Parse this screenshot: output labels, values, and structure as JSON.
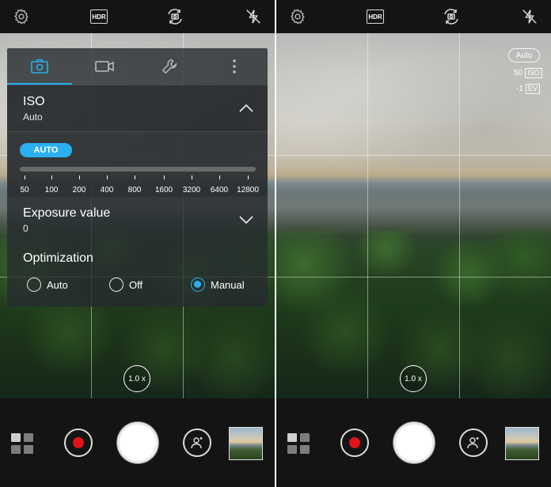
{
  "left": {
    "topbar": {
      "hdr_label": "HDR"
    },
    "panel": {
      "tabs": [
        {
          "name": "photo",
          "icon": "camera-icon",
          "active": true
        },
        {
          "name": "video",
          "icon": "video-camera-icon",
          "active": false
        },
        {
          "name": "tools",
          "icon": "wrench-icon",
          "active": false
        },
        {
          "name": "more",
          "icon": "more-vertical-icon",
          "active": false
        }
      ],
      "iso": {
        "title": "ISO",
        "value": "Auto",
        "auto_label": "AUTO",
        "ticks": [
          "50",
          "100",
          "200",
          "400",
          "800",
          "1600",
          "3200",
          "6400",
          "12800"
        ]
      },
      "exposure": {
        "title": "Exposure value",
        "value": "0"
      },
      "optimization": {
        "title": "Optimization",
        "options": [
          {
            "label": "Auto",
            "selected": false
          },
          {
            "label": "Off",
            "selected": false
          },
          {
            "label": "Manual",
            "selected": true
          }
        ]
      }
    },
    "zoom": "1.0 x"
  },
  "right": {
    "topbar": {
      "hdr_label": "HDR"
    },
    "osd": {
      "mode": "Auto",
      "iso_value": "50",
      "iso_label": "ISO",
      "ev_value": "-1",
      "ev_label": "EV"
    },
    "zoom": "1.0 x"
  },
  "colors": {
    "accent": "#2ab0f0",
    "record": "#e0121b",
    "bar": "#141414"
  }
}
